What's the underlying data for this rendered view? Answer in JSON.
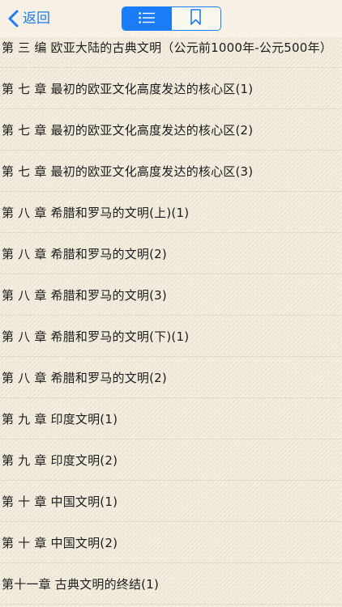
{
  "nav": {
    "back_label": "返回",
    "segments": [
      {
        "icon": "list-icon",
        "selected": true
      },
      {
        "icon": "bookmark-icon",
        "selected": false
      }
    ],
    "accent_color": "#1a7cf6"
  },
  "toc": {
    "items": [
      {
        "title": "第 三 编 欧亚大陆的古典文明（公元前1000年-公元500年）"
      },
      {
        "title": "第 七 章 最初的欧亚文化高度发达的核心区(1)"
      },
      {
        "title": "第 七 章 最初的欧亚文化高度发达的核心区(2)"
      },
      {
        "title": "第 七 章 最初的欧亚文化高度发达的核心区(3)"
      },
      {
        "title": "第 八 章 希腊和罗马的文明(上)(1)"
      },
      {
        "title": "第 八 章 希腊和罗马的文明(2)"
      },
      {
        "title": "第 八 章 希腊和罗马的文明(3)"
      },
      {
        "title": "第 八 章 希腊和罗马的文明(下)(1)"
      },
      {
        "title": "第 八 章 希腊和罗马的文明(2)"
      },
      {
        "title": "第 九 章 印度文明(1)"
      },
      {
        "title": "第 九 章 印度文明(2)"
      },
      {
        "title": "第 十 章 中国文明(1)"
      },
      {
        "title": "第 十 章 中国文明(2)"
      },
      {
        "title": "第十一章 古典文明的终结(1)"
      }
    ]
  }
}
